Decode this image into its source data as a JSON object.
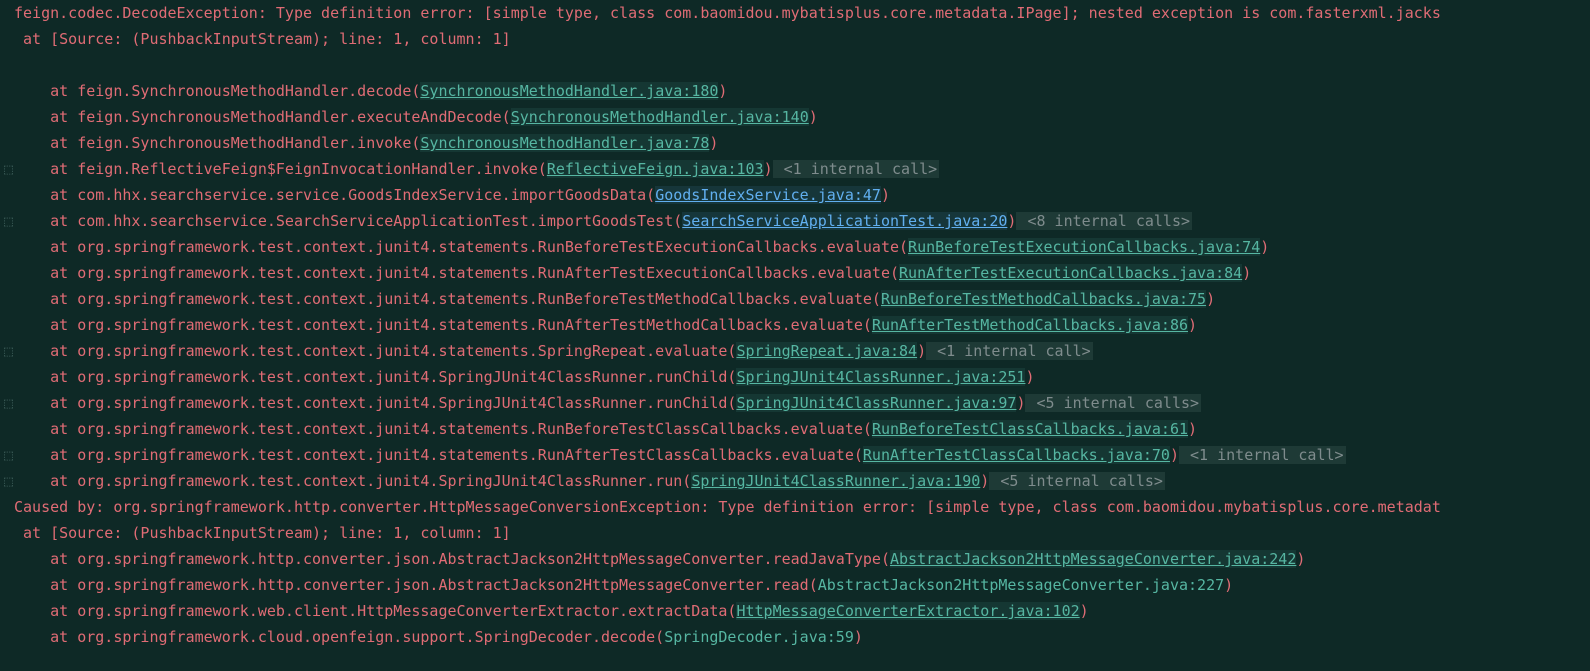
{
  "trace": {
    "line1": "feign.codec.DecodeException: Type definition error: [simple type, class com.baomidou.mybatisplus.core.metadata.IPage]; nested exception is com.fasterxml.jacks",
    "line2": " at [Source: (PushbackInputStream); line: 1, column: 1]",
    "blank": " ",
    "frames": [
      {
        "prefix": "    at feign.SynchronousMethodHandler.decode(",
        "link": "SynchronousMethodHandler.java:180",
        "linkType": "green",
        "suffix": ")",
        "internal": null
      },
      {
        "prefix": "    at feign.SynchronousMethodHandler.executeAndDecode(",
        "link": "SynchronousMethodHandler.java:140",
        "linkType": "green",
        "suffix": ")",
        "internal": null
      },
      {
        "prefix": "    at feign.SynchronousMethodHandler.invoke(",
        "link": "SynchronousMethodHandler.java:78",
        "linkType": "green",
        "suffix": ")",
        "internal": null
      },
      {
        "prefix": "    at feign.ReflectiveFeign$FeignInvocationHandler.invoke(",
        "link": "ReflectiveFeign.java:103",
        "linkType": "green",
        "suffix": ")",
        "internal": " <1 internal call>"
      },
      {
        "prefix": "    at com.hhx.searchservice.service.GoodsIndexService.importGoodsData(",
        "link": "GoodsIndexService.java:47",
        "linkType": "blue",
        "suffix": ")",
        "internal": null
      },
      {
        "prefix": "    at com.hhx.searchservice.SearchServiceApplicationTest.importGoodsTest(",
        "link": "SearchServiceApplicationTest.java:20",
        "linkType": "blue",
        "suffix": ")",
        "internal": " <8 internal calls>"
      },
      {
        "prefix": "    at org.springframework.test.context.junit4.statements.RunBeforeTestExecutionCallbacks.evaluate(",
        "link": "RunBeforeTestExecutionCallbacks.java:74",
        "linkType": "green",
        "suffix": ")",
        "internal": null
      },
      {
        "prefix": "    at org.springframework.test.context.junit4.statements.RunAfterTestExecutionCallbacks.evaluate(",
        "link": "RunAfterTestExecutionCallbacks.java:84",
        "linkType": "green",
        "suffix": ")",
        "internal": null
      },
      {
        "prefix": "    at org.springframework.test.context.junit4.statements.RunBeforeTestMethodCallbacks.evaluate(",
        "link": "RunBeforeTestMethodCallbacks.java:75",
        "linkType": "green",
        "suffix": ")",
        "internal": null
      },
      {
        "prefix": "    at org.springframework.test.context.junit4.statements.RunAfterTestMethodCallbacks.evaluate(",
        "link": "RunAfterTestMethodCallbacks.java:86",
        "linkType": "green",
        "suffix": ")",
        "internal": null
      },
      {
        "prefix": "    at org.springframework.test.context.junit4.statements.SpringRepeat.evaluate(",
        "link": "SpringRepeat.java:84",
        "linkType": "green",
        "suffix": ")",
        "internal": " <1 internal call>"
      },
      {
        "prefix": "    at org.springframework.test.context.junit4.SpringJUnit4ClassRunner.runChild(",
        "link": "SpringJUnit4ClassRunner.java:251",
        "linkType": "green",
        "suffix": ")",
        "internal": null
      },
      {
        "prefix": "    at org.springframework.test.context.junit4.SpringJUnit4ClassRunner.runChild(",
        "link": "SpringJUnit4ClassRunner.java:97",
        "linkType": "green",
        "suffix": ")",
        "internal": " <5 internal calls>"
      },
      {
        "prefix": "    at org.springframework.test.context.junit4.statements.RunBeforeTestClassCallbacks.evaluate(",
        "link": "RunBeforeTestClassCallbacks.java:61",
        "linkType": "green",
        "suffix": ")",
        "internal": null
      },
      {
        "prefix": "    at org.springframework.test.context.junit4.statements.RunAfterTestClassCallbacks.evaluate(",
        "link": "RunAfterTestClassCallbacks.java:70",
        "linkType": "green",
        "suffix": ")",
        "internal": " <1 internal call>"
      },
      {
        "prefix": "    at org.springframework.test.context.junit4.SpringJUnit4ClassRunner.run(",
        "link": "SpringJUnit4ClassRunner.java:190",
        "linkType": "green",
        "suffix": ")",
        "internal": " <5 internal calls>"
      }
    ],
    "caused": "Caused by: org.springframework.http.converter.HttpMessageConversionException: Type definition error: [simple type, class com.baomidou.mybatisplus.core.metadat",
    "causedAt": " at [Source: (PushbackInputStream); line: 1, column: 1]",
    "frames2": [
      {
        "prefix": "    at org.springframework.http.converter.json.AbstractJackson2HttpMessageConverter.readJavaType(",
        "link": "AbstractJackson2HttpMessageConverter.java:242",
        "linkType": "green",
        "suffix": ")",
        "internal": null
      },
      {
        "prefix": "    at org.springframework.http.converter.json.AbstractJackson2HttpMessageConverter.read(",
        "link": "AbstractJackson2HttpMessageConverter.java:227",
        "linkType": "green-plain",
        "suffix": ")",
        "internal": null
      },
      {
        "prefix": "    at org.springframework.web.client.HttpMessageConverterExtractor.extractData(",
        "link": "HttpMessageConverterExtractor.java:102",
        "linkType": "green",
        "suffix": ")",
        "internal": null
      },
      {
        "prefix": "    at org.springframework.cloud.openfeign.support.SpringDecoder.decode(",
        "link": "SpringDecoder.java:59",
        "linkType": "green-plain",
        "suffix": ")",
        "internal": null
      }
    ]
  }
}
